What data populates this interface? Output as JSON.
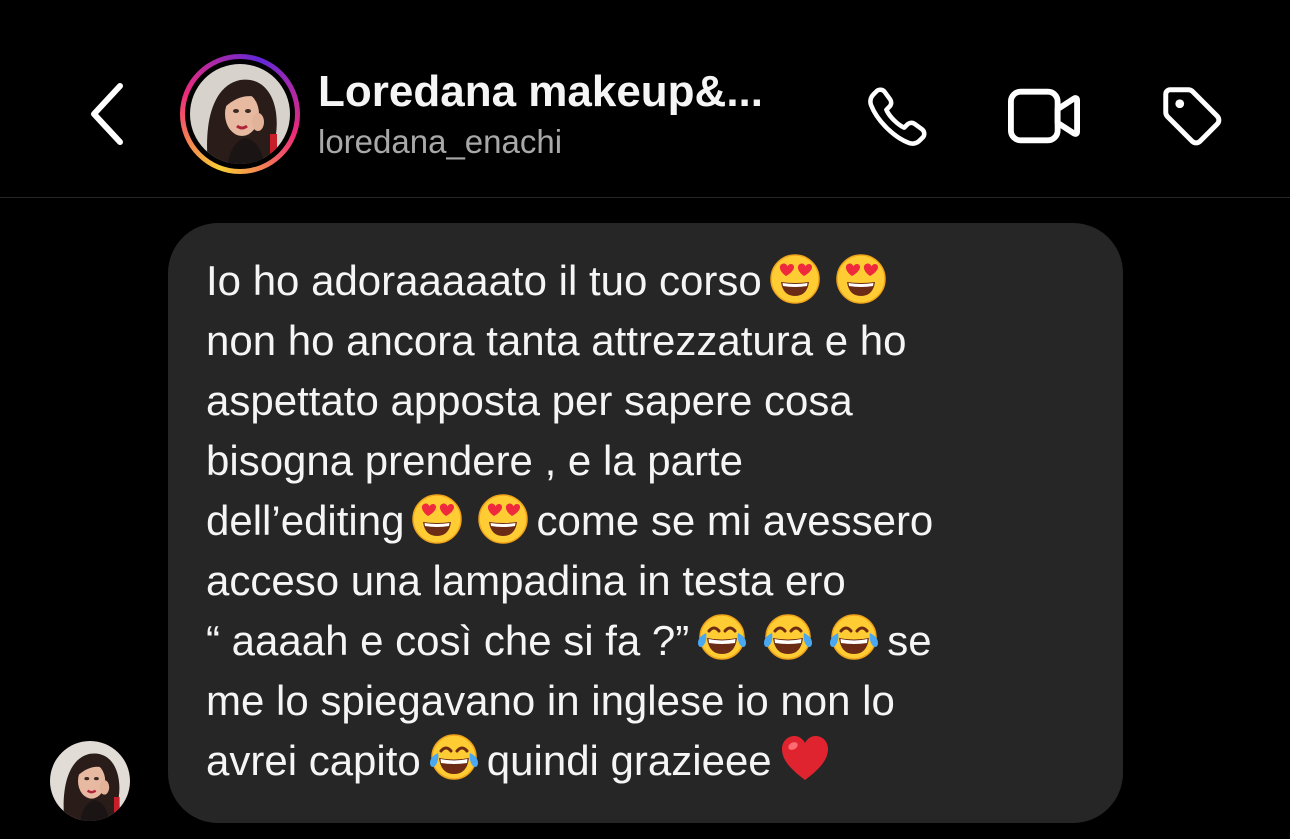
{
  "header": {
    "back_icon": "chevron-left-icon",
    "display_name": "Loredana makeup&...",
    "username": "loredana_enachi",
    "call_icon": "phone-icon",
    "video_icon": "video-camera-icon",
    "tag_icon": "tag-icon",
    "story_ring_colors": [
      "#f9ce34",
      "#ee2a7b",
      "#6228d7"
    ]
  },
  "message": {
    "bubble_color": "#262626",
    "text_color": "#f5f5f5",
    "segments": [
      {
        "text": "Io ho adoraaaaato il tuo corso"
      },
      {
        "emoji": "heart-eyes"
      },
      {
        "emoji": "heart-eyes"
      },
      {
        "text": "\nnon ho ancora tanta attrezzatura e ho\naspettato apposta per sapere cosa\nbisogna prendere , e la parte\ndell’editing"
      },
      {
        "emoji": "heart-eyes"
      },
      {
        "emoji": "heart-eyes"
      },
      {
        "text": "come se mi avessero\nacceso una lampadina in testa ero\n“ aaaah e così che si fa ?”"
      },
      {
        "emoji": "tears-of-joy"
      },
      {
        "emoji": "tears-of-joy"
      },
      {
        "emoji": "tears-of-joy"
      },
      {
        "text": "se\nme lo spiegavano in inglese io non lo\navrei capito"
      },
      {
        "emoji": "tears-of-joy"
      },
      {
        "text": "quindi grazieee"
      },
      {
        "emoji": "red-heart"
      }
    ]
  },
  "sender_avatar": "avatar-icon"
}
